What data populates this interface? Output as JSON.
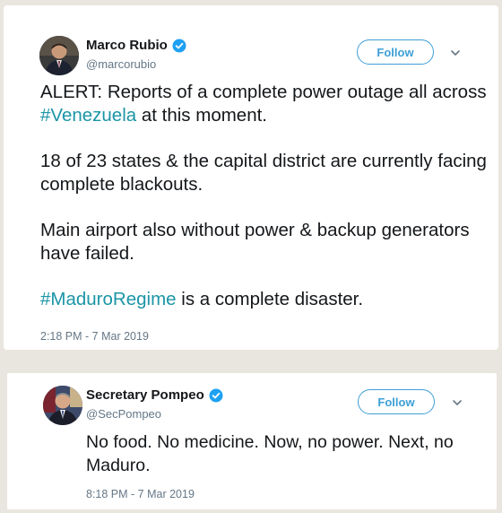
{
  "colors": {
    "accent": "#3d9fd6",
    "hashtag": "#1b95a6",
    "text": "#14171a",
    "muted": "#657786"
  },
  "tweets": [
    {
      "display_name": "Marco Rubio",
      "handle": "@marcorubio",
      "verified": true,
      "follow_label": "Follow",
      "paragraphs": [
        {
          "text_1": "ALERT: Reports of a complete power outage all across ",
          "hashtag": "#Venezuela",
          "text_2": " at this moment."
        },
        {
          "text": "18 of 23 states & the capital district are currently facing complete blackouts."
        },
        {
          "text": "Main airport also without power & backup generators have failed."
        },
        {
          "hashtag": "#MaduroRegime",
          "text_2": " is a complete disaster."
        }
      ],
      "timestamp": "2:18 PM - 7 Mar 2019",
      "icons": [
        "verified-badge-icon",
        "chevron-down-icon"
      ]
    },
    {
      "display_name": "Secretary Pompeo",
      "handle": "@SecPompeo",
      "verified": true,
      "follow_label": "Follow",
      "text": "No food. No medicine. Now, no power. Next, no Maduro.",
      "timestamp": "8:18 PM - 7 Mar 2019",
      "icons": [
        "verified-badge-icon",
        "chevron-down-icon"
      ]
    }
  ]
}
